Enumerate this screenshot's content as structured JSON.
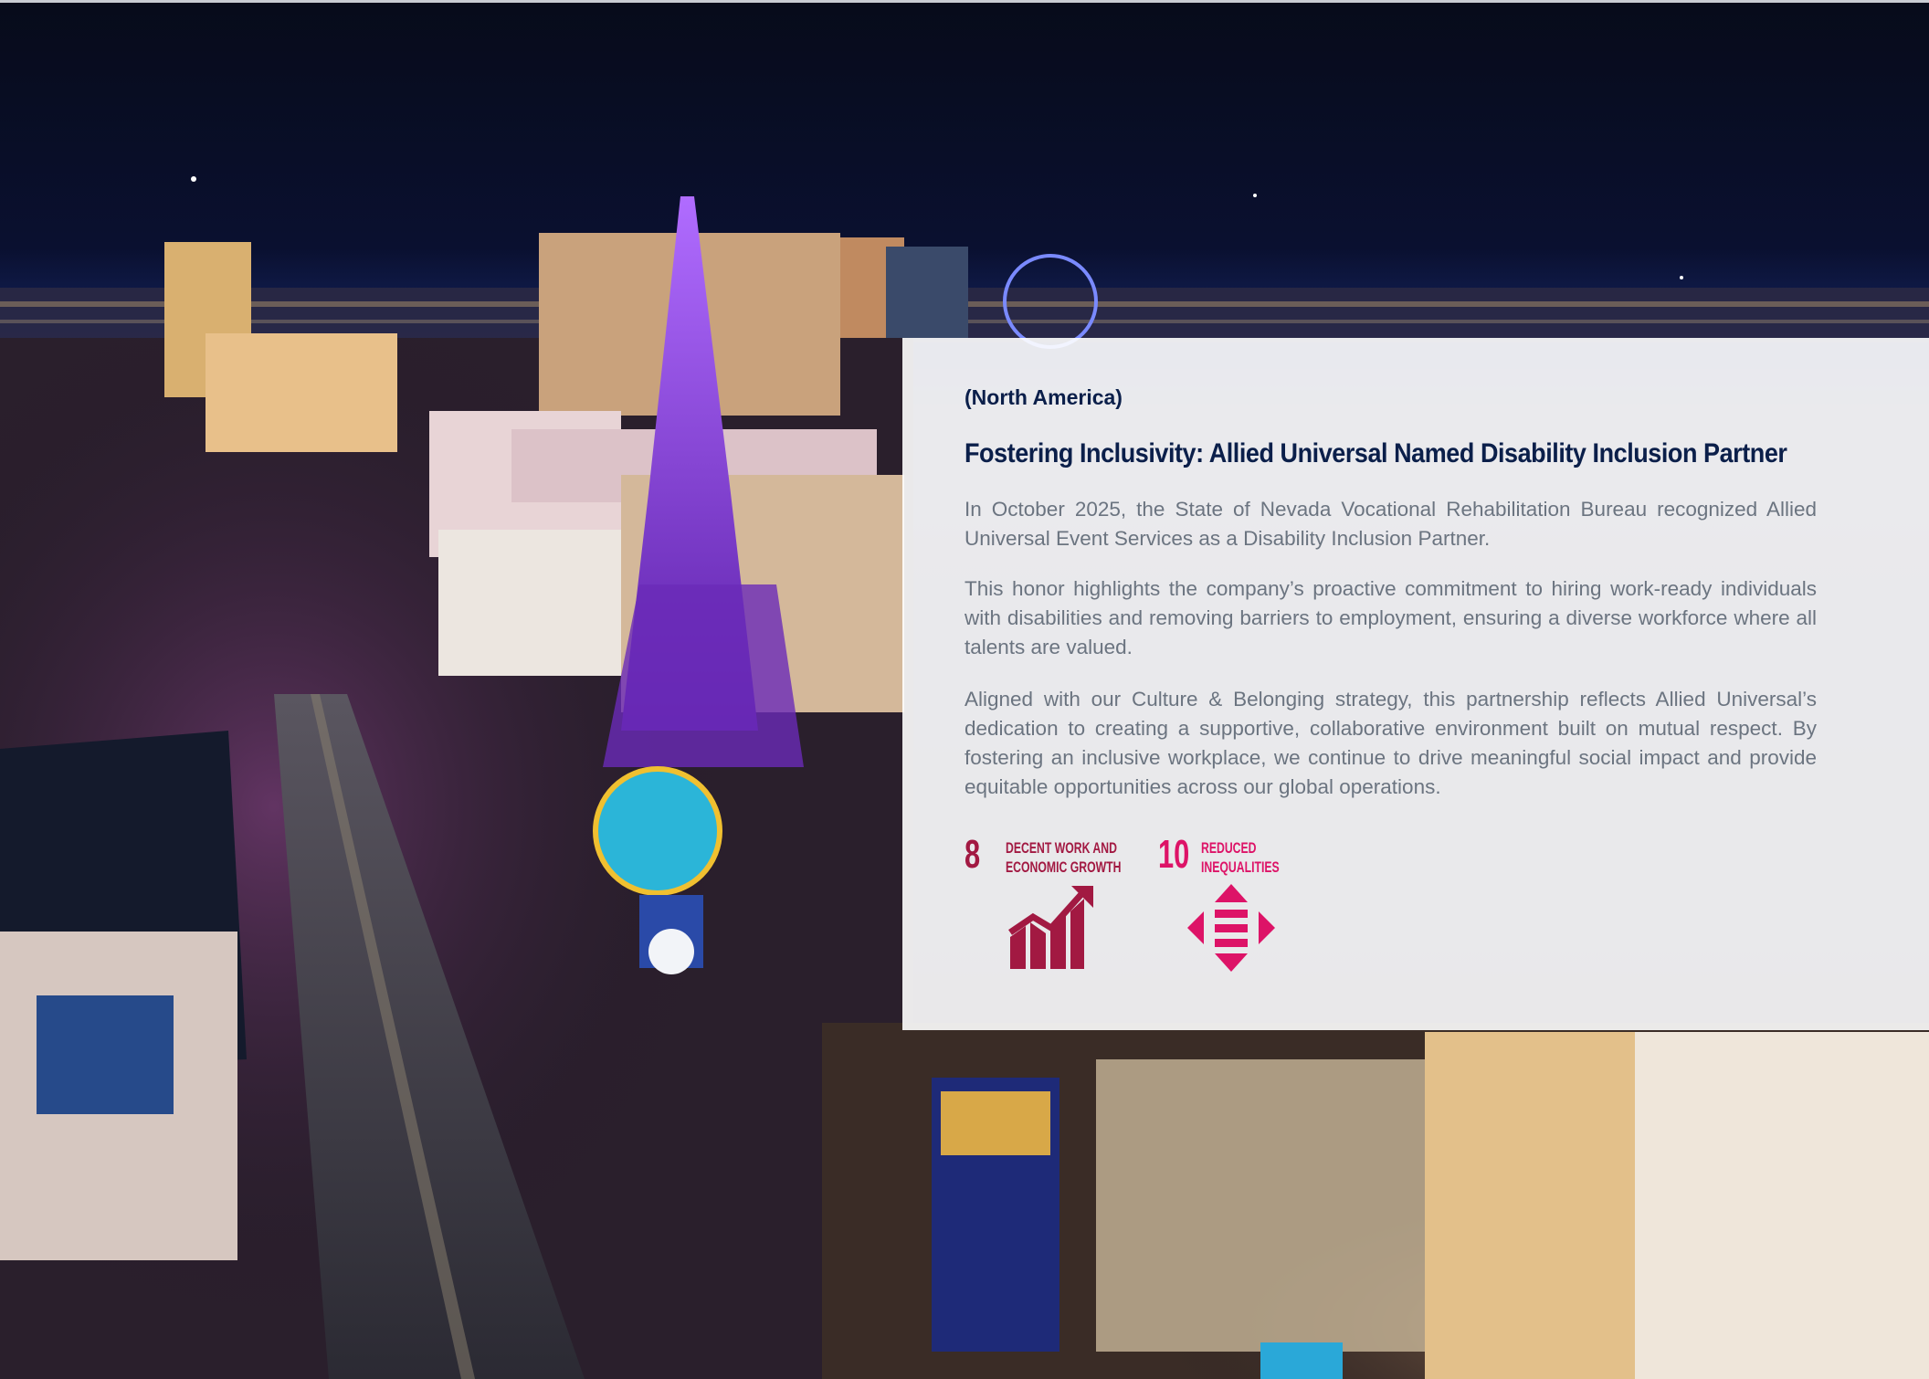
{
  "article": {
    "region": "(North America)",
    "headline": "Fostering Inclusivity: Allied Universal Named Disability Inclusion Partner",
    "paragraphs": [
      "In October 2025, the State of Nevada Vocational Rehabilitation Bureau recognized Allied Universal Event Services as a Disability Inclusion Partner.",
      "This honor highlights the company’s proactive commitment to hiring work-ready individuals with disabilities and removing barriers to employment, ensuring a diverse workforce where all talents are valued.",
      "Aligned with our Culture & Belonging strategy, this partnership reflects Allied Universal’s dedication to creating a supportive, collaborative environment built on mutual respect. By fostering an inclusive workplace, we continue to drive meaningful social impact and provide equitable opportunities across our global operations."
    ]
  },
  "sdg_goals": [
    {
      "number": "8",
      "title": "DECENT WORK AND\nECONOMIC GROWTH",
      "icon": "growth-chart-icon",
      "color": "#a21942"
    },
    {
      "number": "10",
      "title": "REDUCED\nINEQUALITIES",
      "icon": "equality-arrows-icon",
      "color": "#dd1367"
    }
  ],
  "background": {
    "description_icon": "city-night-photo",
    "sky_color": "#0a0f24",
    "accent_purple": "#8a3cff"
  }
}
